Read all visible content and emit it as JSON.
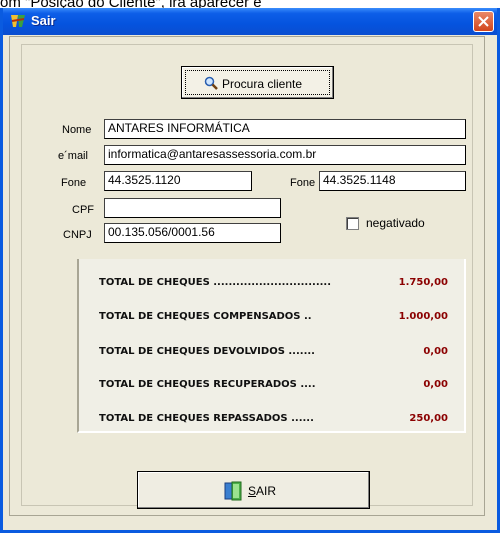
{
  "background_text": "om \"Posição do Cliente\", irá aparecer e",
  "window": {
    "title": "Sair"
  },
  "search": {
    "button_label": "Procura cliente"
  },
  "form": {
    "nome_label": "Nome",
    "nome_value": "ANTARES INFORMÁTICA",
    "email_label": "e´mail",
    "email_value": "informatica@antaresassessoria.com.br",
    "fone1_label": "Fone",
    "fone1_value": "44.3525.1120",
    "fone2_label": "Fone",
    "fone2_value": "44.3525.1148",
    "cpf_label": "CPF",
    "cpf_value": "",
    "cnpj_label": "CNPJ",
    "cnpj_value": "00.135.056/0001.56",
    "negativado_label": "negativado",
    "negativado_checked": false
  },
  "totals": [
    {
      "label": "TOTAL DE CHEQUES ...............................",
      "value": "1.750,00"
    },
    {
      "label": "TOTAL DE CHEQUES COMPENSADOS ..",
      "value": "1.000,00"
    },
    {
      "label": "TOTAL DE CHEQUES DEVOLVIDOS .......",
      "value": "0,00"
    },
    {
      "label": "TOTAL DE CHEQUES RECUPERADOS ....",
      "value": "0,00"
    },
    {
      "label": "TOTAL DE CHEQUES REPASSADOS ......",
      "value": "250,00"
    }
  ],
  "exit_button": {
    "mnemonic": "S",
    "rest": "AIR"
  },
  "colors": {
    "titlebar": "#0553de",
    "value_red": "#8b0000",
    "window_bg": "#ece9d8"
  },
  "icons": {
    "app": "app-logo-icon",
    "search": "magnifier-icon",
    "exit": "exit-door-icon",
    "close": "close-icon"
  }
}
